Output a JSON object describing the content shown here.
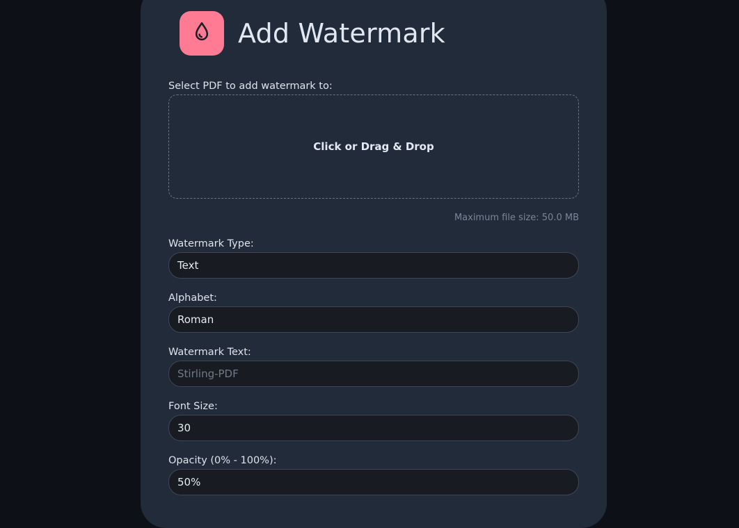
{
  "page": {
    "title": "Add Watermark",
    "logo_icon": "water-drop-icon",
    "accent_color": "#ff7a93"
  },
  "upload": {
    "label": "Select PDF to add watermark to:",
    "dropzone_text": "Click or Drag & Drop",
    "max_size": "Maximum file size: 50.0 MB"
  },
  "form": {
    "watermark_type": {
      "label": "Watermark Type:",
      "value": "Text"
    },
    "alphabet": {
      "label": "Alphabet:",
      "value": "Roman"
    },
    "watermark_text": {
      "label": "Watermark Text:",
      "placeholder": "Stirling-PDF"
    },
    "font_size": {
      "label": "Font Size:",
      "value": "30"
    },
    "opacity": {
      "label": "Opacity (0% - 100%):",
      "value": "50%"
    }
  }
}
